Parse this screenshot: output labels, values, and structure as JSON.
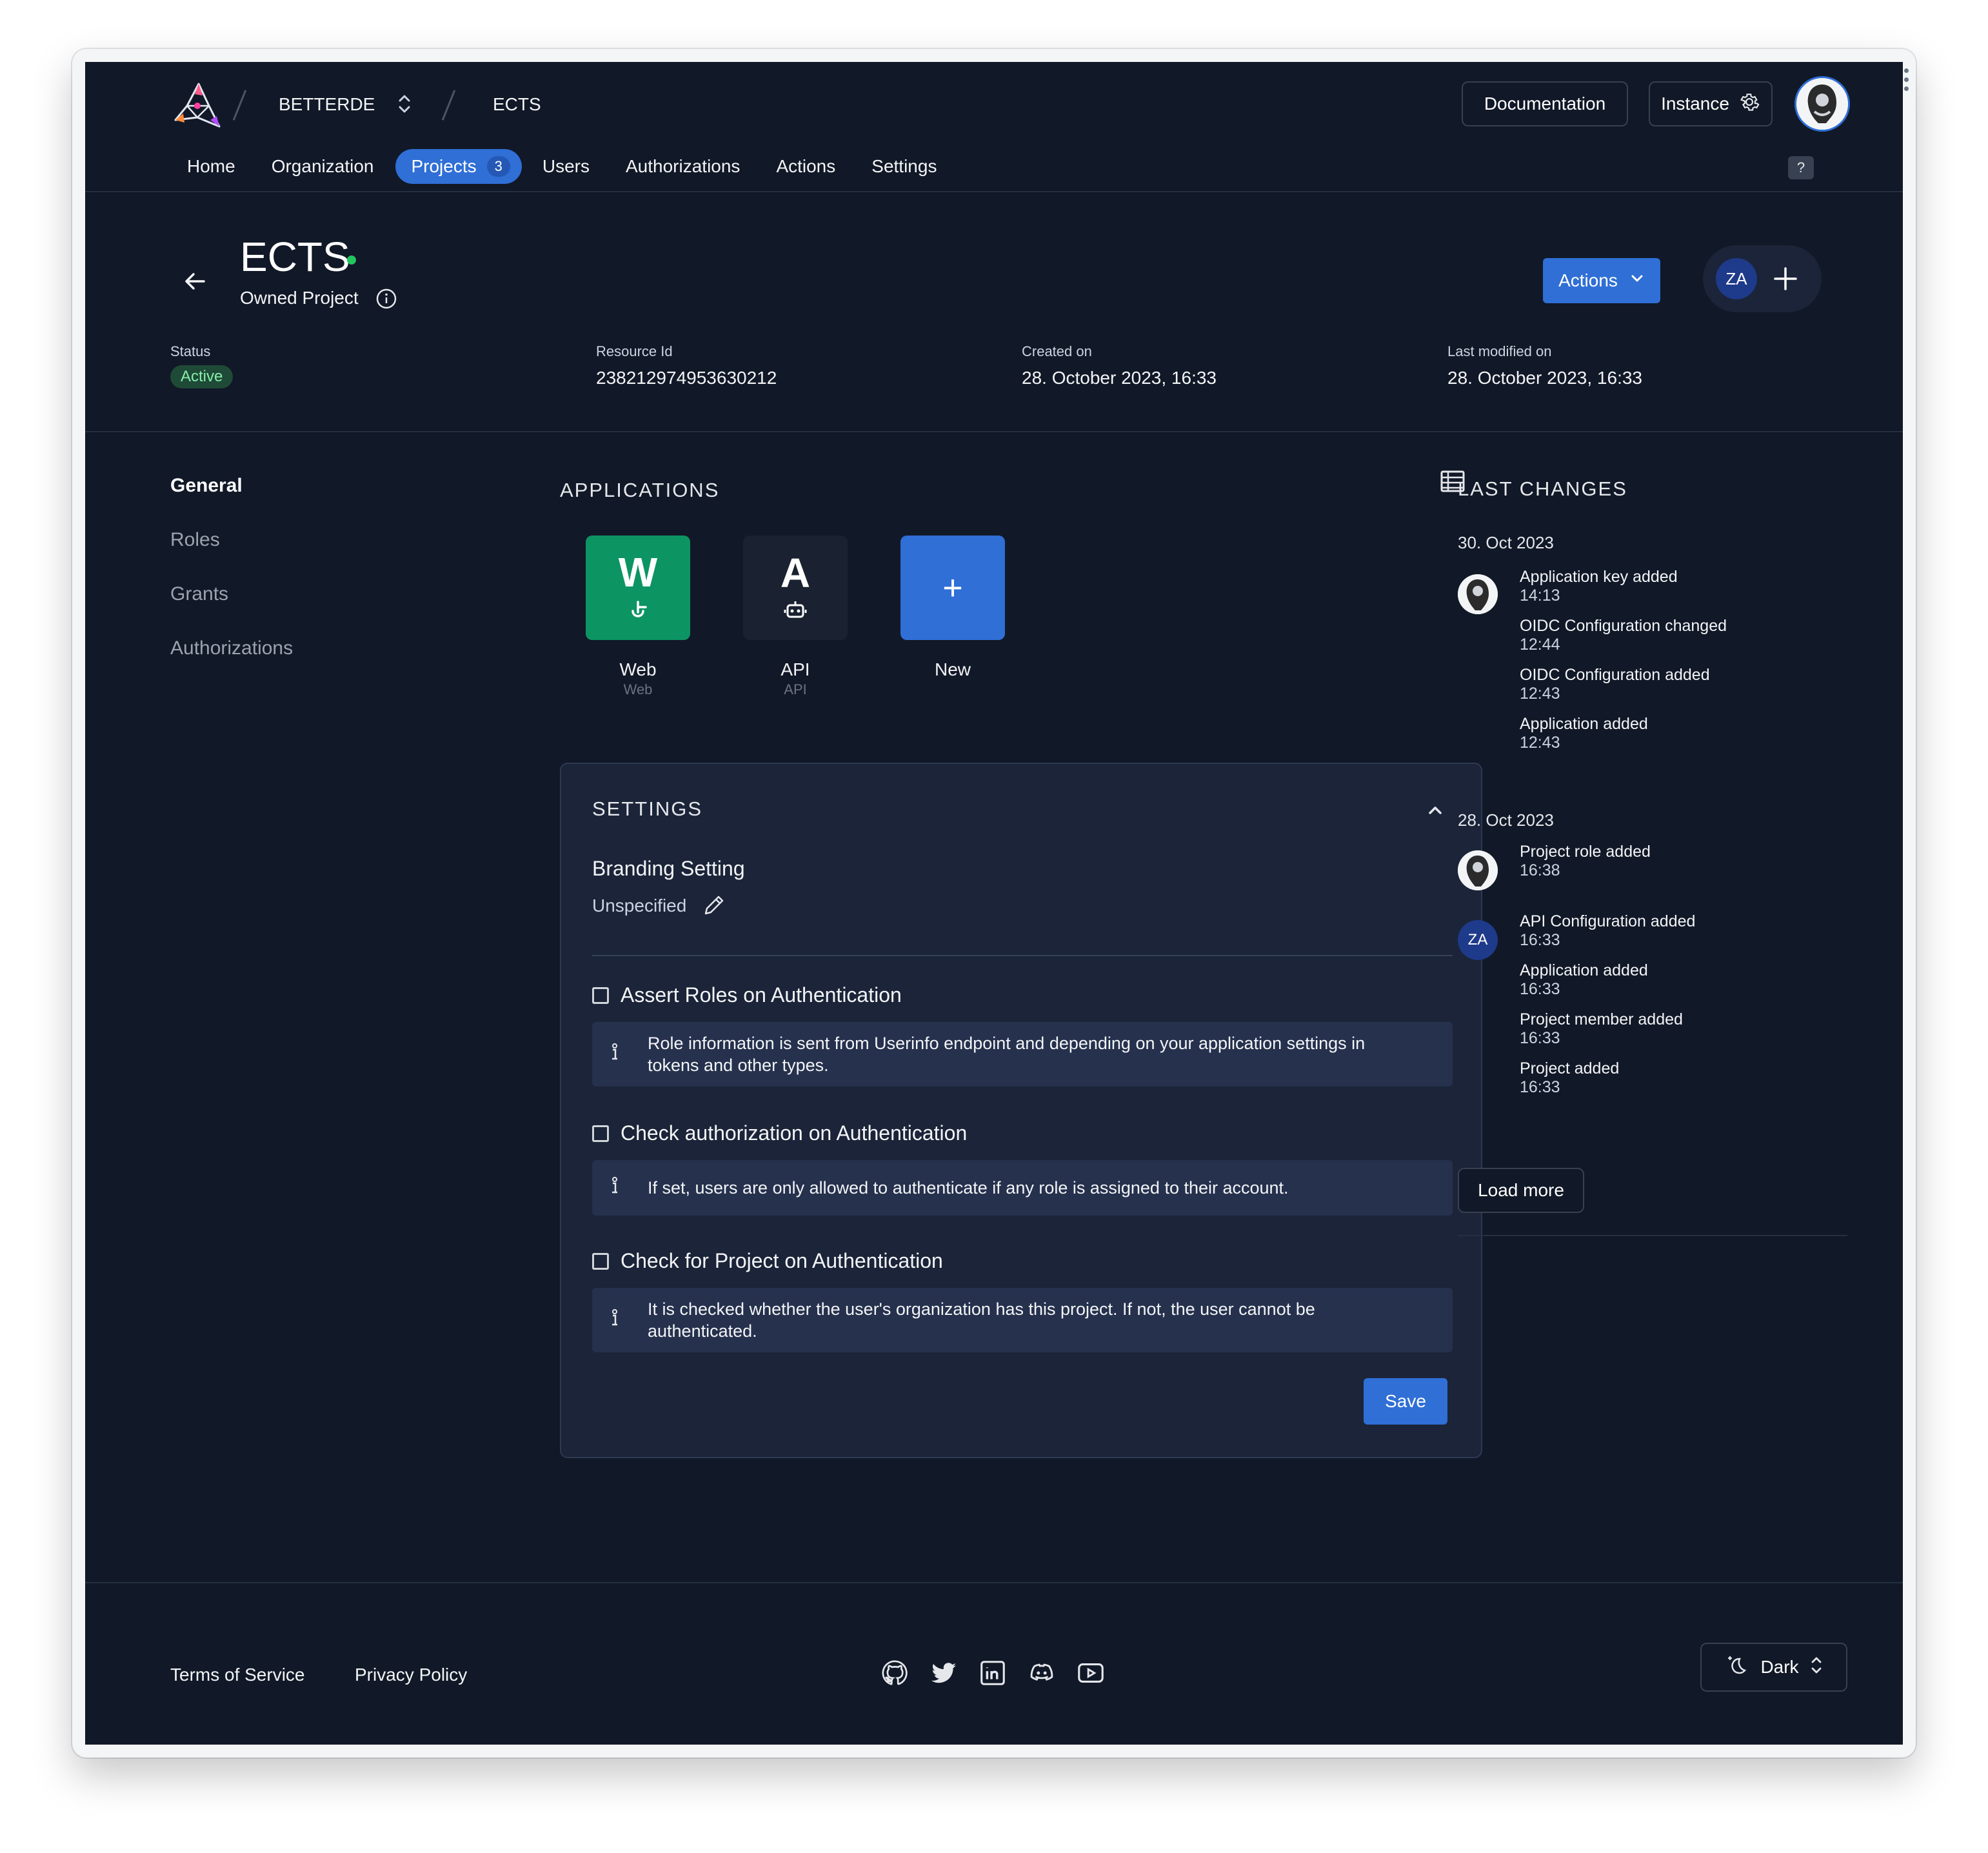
{
  "header": {
    "org_name": "BETTERDE",
    "project_crumb": "ECTS",
    "documentation_label": "Documentation",
    "instance_label": "Instance"
  },
  "nav": {
    "items": [
      {
        "label": "Home"
      },
      {
        "label": "Organization"
      },
      {
        "label": "Projects",
        "badge": "3",
        "active": true
      },
      {
        "label": "Users"
      },
      {
        "label": "Authorizations"
      },
      {
        "label": "Actions"
      },
      {
        "label": "Settings"
      }
    ],
    "help_label": "?"
  },
  "project": {
    "title": "ECTS",
    "subtitle": "Owned Project",
    "actions_label": "Actions",
    "member_initials": "ZA",
    "status_label": "Status",
    "status_value": "Active",
    "resource_id_label": "Resource Id",
    "resource_id": "238212974953630212",
    "created_label": "Created on",
    "created_value": "28. October 2023, 16:33",
    "modified_label": "Last modified on",
    "modified_value": "28. October 2023, 16:33"
  },
  "side_menu": [
    "General",
    "Roles",
    "Grants",
    "Authorizations"
  ],
  "applications": {
    "title": "APPLICATIONS",
    "items": [
      {
        "letter": "W",
        "name": "Web",
        "type": "Web",
        "color": "#0d9463"
      },
      {
        "letter": "A",
        "name": "API",
        "type": "API",
        "color": "#1a2130"
      }
    ],
    "new_label": "New",
    "new_symbol": "+",
    "new_color": "#2f6fd6"
  },
  "settings": {
    "title": "SETTINGS",
    "branding_title": "Branding Setting",
    "branding_value": "Unspecified",
    "options": [
      {
        "label": "Assert Roles on Authentication",
        "info": "Role information is sent from Userinfo endpoint and depending on your application settings in tokens and other types."
      },
      {
        "label": "Check authorization on Authentication",
        "info": "If set, users are only allowed to authenticate if any role is assigned to their account."
      },
      {
        "label": "Check for Project on Authentication",
        "info": "It is checked whether the user's organization has this project. If not, the user cannot be authenticated."
      }
    ],
    "save_label": "Save"
  },
  "last_changes": {
    "title": "LAST CHANGES",
    "groups": [
      {
        "date": "30. Oct 2023",
        "avatar": "user-photo",
        "entries": [
          {
            "title": "Application key added",
            "time": "14:13"
          },
          {
            "title": "OIDC Configuration changed",
            "time": "12:44"
          },
          {
            "title": "OIDC Configuration added",
            "time": "12:43"
          },
          {
            "title": "Application added",
            "time": "12:43"
          }
        ]
      },
      {
        "date": "28. Oct 2023",
        "avatar": "user-photo",
        "entries": [
          {
            "title": "Project role added",
            "time": "16:38"
          }
        ]
      },
      {
        "avatar": "ZA",
        "entries": [
          {
            "title": "API Configuration added",
            "time": "16:33"
          },
          {
            "title": "Application added",
            "time": "16:33"
          },
          {
            "title": "Project member added",
            "time": "16:33"
          },
          {
            "title": "Project added",
            "time": "16:33"
          }
        ]
      }
    ],
    "load_more_label": "Load more"
  },
  "footer": {
    "terms_label": "Terms of Service",
    "privacy_label": "Privacy Policy",
    "social_icons": [
      "github-icon",
      "twitter-icon",
      "linkedin-icon",
      "discord-icon",
      "youtube-icon"
    ],
    "theme_label": "Dark"
  },
  "colors": {
    "background": "#111827",
    "accent": "#2f6fd6",
    "status_active": "#22c55e",
    "web_app": "#0d9463",
    "avatar_za": "#1e3a8a"
  }
}
